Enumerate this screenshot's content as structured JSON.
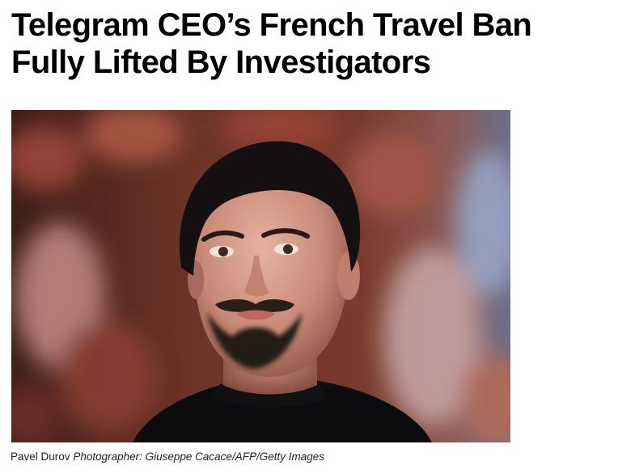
{
  "article": {
    "headline_line1": "Telegram CEO’s French Travel Ban",
    "headline_line2": "Fully Lifted By Investigators",
    "photo": {
      "subject_icon": "portrait-photo"
    },
    "caption": {
      "subject": "Pavel Durov",
      "credit": "Photographer: Giuseppe Cacace/AFP/Getty Images"
    }
  }
}
